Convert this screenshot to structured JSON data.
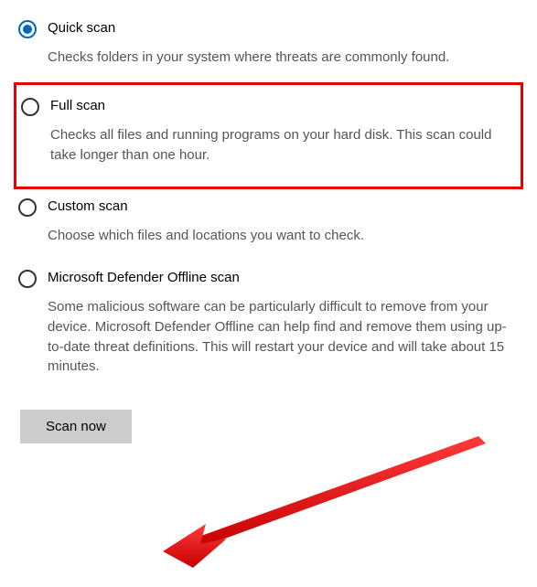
{
  "options": [
    {
      "id": "quick",
      "title": "Quick scan",
      "desc": "Checks folders in your system where threats are commonly found.",
      "checked": true,
      "highlighted": false
    },
    {
      "id": "full",
      "title": "Full scan",
      "desc": "Checks all files and running programs on your hard disk. This scan could take longer than one hour.",
      "checked": false,
      "highlighted": true
    },
    {
      "id": "custom",
      "title": "Custom scan",
      "desc": "Choose which files and locations you want to check.",
      "checked": false,
      "highlighted": false
    },
    {
      "id": "offline",
      "title": "Microsoft Defender Offline scan",
      "desc": "Some malicious software can be particularly difficult to remove from your device. Microsoft Defender Offline can help find and remove them using up-to-date threat definitions. This will restart your device and will take about 15 minutes.",
      "checked": false,
      "highlighted": false
    }
  ],
  "button": {
    "label": "Scan now"
  },
  "annotation": {
    "highlight_color": "#e80000",
    "arrow_color": "#ff0000"
  }
}
